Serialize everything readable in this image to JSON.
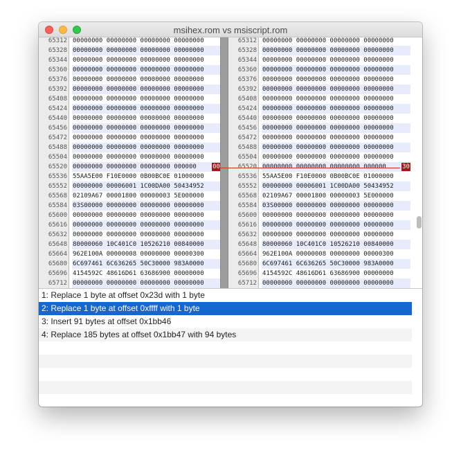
{
  "window": {
    "title": "msihex.rom vs msiscript.rom"
  },
  "left_pane": {
    "rows": [
      {
        "offset": "65312",
        "hex": "00000000 00000000 00000000 00000000",
        "shade": false
      },
      {
        "offset": "65328",
        "hex": "00000000 00000000 00000000 00000000",
        "shade": true
      },
      {
        "offset": "65344",
        "hex": "00000000 00000000 00000000 00000000",
        "shade": false
      },
      {
        "offset": "65360",
        "hex": "00000000 00000000 00000000 00000000",
        "shade": true
      },
      {
        "offset": "65376",
        "hex": "00000000 00000000 00000000 00000000",
        "shade": false
      },
      {
        "offset": "65392",
        "hex": "00000000 00000000 00000000 00000000",
        "shade": true
      },
      {
        "offset": "65408",
        "hex": "00000000 00000000 00000000 00000000",
        "shade": false
      },
      {
        "offset": "65424",
        "hex": "00000000 00000000 00000000 00000000",
        "shade": true
      },
      {
        "offset": "65440",
        "hex": "00000000 00000000 00000000 00000000",
        "shade": false
      },
      {
        "offset": "65456",
        "hex": "00000000 00000000 00000000 00000000",
        "shade": true
      },
      {
        "offset": "65472",
        "hex": "00000000 00000000 00000000 00000000",
        "shade": false
      },
      {
        "offset": "65488",
        "hex": "00000000 00000000 00000000 00000000",
        "shade": true
      },
      {
        "offset": "65504",
        "hex": "00000000 00000000 00000000 00000000",
        "shade": false
      },
      {
        "offset": "65520",
        "hex": "00000000 00000000 00000000 000000",
        "shade": true,
        "highlight": "00"
      },
      {
        "offset": "65536",
        "hex": "55AA5E00 F10E0000 0B00BC0E 01000000",
        "shade": false
      },
      {
        "offset": "65552",
        "hex": "00000000 00006001 1C00DA00 50434952",
        "shade": true
      },
      {
        "offset": "65568",
        "hex": "02109A67 00001800 00000003 5E000000",
        "shade": false
      },
      {
        "offset": "65584",
        "hex": "03S00000 00000000 00000000 00000000",
        "shade": true
      },
      {
        "offset": "65600",
        "hex": "00000000 00000000 00000000 00000000",
        "shade": false
      },
      {
        "offset": "65616",
        "hex": "00000000 00000000 00000000 00000000",
        "shade": true
      },
      {
        "offset": "65632",
        "hex": "00000000 00000000 00000000 00000000",
        "shade": false
      },
      {
        "offset": "65648",
        "hex": "80000060 10C401C0 10526210 00840000",
        "shade": true
      },
      {
        "offset": "65664",
        "hex": "962E100A 00000008 00000000 00000300",
        "shade": false
      },
      {
        "offset": "65680",
        "hex": "6C697461 6C636265 50C30000 983A0000",
        "shade": true
      },
      {
        "offset": "65696",
        "hex": "4154592C 48616D61 63686900 00000000",
        "shade": false
      },
      {
        "offset": "65712",
        "hex": "00000000 00000000 00000000 00000000",
        "shade": true
      }
    ]
  },
  "right_pane": {
    "rows": [
      {
        "offset": "65312",
        "hex": "00000000 00000000 00000000 00000000",
        "shade": false
      },
      {
        "offset": "65328",
        "hex": "00000000 00000000 00000000 00000000",
        "shade": true
      },
      {
        "offset": "65344",
        "hex": "00000000 00000000 00000000 00000000",
        "shade": false
      },
      {
        "offset": "65360",
        "hex": "00000000 00000000 00000000 00000000",
        "shade": true
      },
      {
        "offset": "65376",
        "hex": "00000000 00000000 00000000 00000000",
        "shade": false
      },
      {
        "offset": "65392",
        "hex": "00000000 00000000 00000000 00000000",
        "shade": true
      },
      {
        "offset": "65408",
        "hex": "00000000 00000000 00000000 00000000",
        "shade": false
      },
      {
        "offset": "65424",
        "hex": "00000000 00000000 00000000 00000000",
        "shade": true
      },
      {
        "offset": "65440",
        "hex": "00000000 00000000 00000000 00000000",
        "shade": false
      },
      {
        "offset": "65456",
        "hex": "00000000 00000000 00000000 00000000",
        "shade": true
      },
      {
        "offset": "65472",
        "hex": "00000000 00000000 00000000 00000000",
        "shade": false
      },
      {
        "offset": "65488",
        "hex": "00000000 00000000 00000000 00000000",
        "shade": true
      },
      {
        "offset": "65504",
        "hex": "00000000 00000000 00000000 00000000",
        "shade": false
      },
      {
        "offset": "65520",
        "hex": "00000000 00000000 00000000 000000",
        "shade": true,
        "highlight": "30"
      },
      {
        "offset": "65536",
        "hex": "55AA5E00 F10E0000 0B00BC0E 01000000",
        "shade": false
      },
      {
        "offset": "65552",
        "hex": "00000000 00006001 1C00DA00 50434952",
        "shade": true
      },
      {
        "offset": "65568",
        "hex": "02109A67 00001800 00000003 5E000000",
        "shade": false
      },
      {
        "offset": "65584",
        "hex": "03S00000 00000000 00000000 00000000",
        "shade": true
      },
      {
        "offset": "65600",
        "hex": "00000000 00000000 00000000 00000000",
        "shade": false
      },
      {
        "offset": "65616",
        "hex": "00000000 00000000 00000000 00000000",
        "shade": true
      },
      {
        "offset": "65632",
        "hex": "00000000 00000000 00000000 00000000",
        "shade": false
      },
      {
        "offset": "65648",
        "hex": "80000060 10C401C0 10526210 00840000",
        "shade": true
      },
      {
        "offset": "65664",
        "hex": "962E100A 00000008 00000000 00000300",
        "shade": false
      },
      {
        "offset": "65680",
        "hex": "6C697461 6C636265 50C30000 983A0000",
        "shade": true
      },
      {
        "offset": "65696",
        "hex": "4154592C 48616D61 63686900 00000000",
        "shade": false
      },
      {
        "offset": "65712",
        "hex": "00000000 00000000 00000000 00000000",
        "shade": true
      }
    ]
  },
  "diff_list": {
    "items": [
      {
        "label": "1: Replace 1 byte at offset 0x23d with 1 byte",
        "selected": false
      },
      {
        "label": "2: Replace 1 byte at offset 0xffff with 1 byte",
        "selected": true
      },
      {
        "label": "3: Insert 91 bytes at offset 0x1bb46",
        "selected": false
      },
      {
        "label": "4: Replace 185 bytes at offset 0x1bb47 with 94 bytes",
        "selected": false
      }
    ],
    "empty_rows": 5
  },
  "colors": {
    "highlight": "#9e1a1a",
    "selection": "#1566d1",
    "row_shade": "#e7ebfb"
  }
}
